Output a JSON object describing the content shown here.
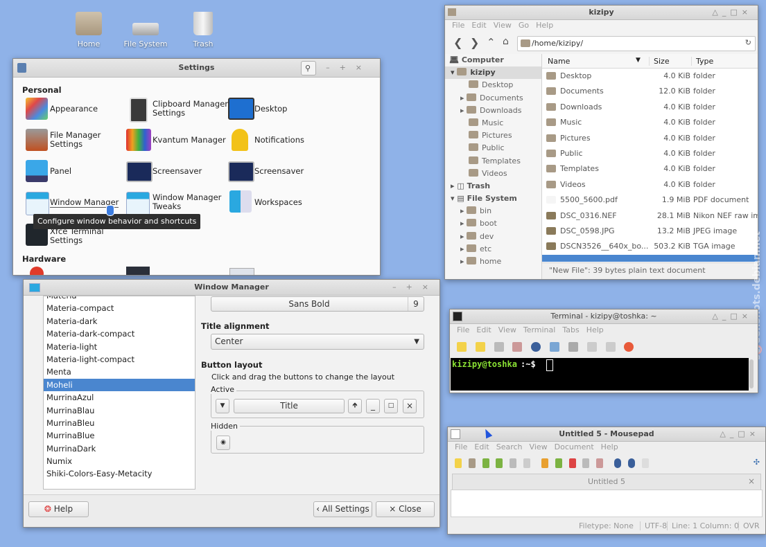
{
  "desktop": {
    "icons": [
      {
        "label": "Home"
      },
      {
        "label": "File System"
      },
      {
        "label": "Trash"
      }
    ]
  },
  "settings": {
    "title": "Settings",
    "personal_heading": "Personal",
    "hardware_heading": "Hardware",
    "items": [
      {
        "label": "Appearance"
      },
      {
        "label": "Clipboard Manager\nSettings"
      },
      {
        "label": "Desktop"
      },
      {
        "label": "File Manager\nSettings"
      },
      {
        "label": "Kvantum Manager"
      },
      {
        "label": "Notifications"
      },
      {
        "label": "Panel"
      },
      {
        "label": "Screensaver"
      },
      {
        "label": "Screensaver"
      },
      {
        "label": "Window Manager"
      },
      {
        "label": "Window Manager\nTweaks"
      },
      {
        "label": "Workspaces"
      },
      {
        "label": "Xfce Terminal\nSettings"
      }
    ],
    "tooltip": "Configure window behavior and shortcuts"
  },
  "wm": {
    "title": "Window Manager",
    "themes": [
      "Materia",
      "Materia-compact",
      "Materia-dark",
      "Materia-dark-compact",
      "Materia-light",
      "Materia-light-compact",
      "Menta",
      "Moheli",
      "MurrinaAzul",
      "MurrinaBlau",
      "MurrinaBleu",
      "MurrinaBlue",
      "MurrinaDark",
      "Numix",
      "Shiki-Colors-Easy-Metacity"
    ],
    "selected_theme": "Moheli",
    "font_name": "Sans Bold",
    "font_size": "9",
    "title_alignment_heading": "Title alignment",
    "title_alignment_value": "Center",
    "button_layout_heading": "Button layout",
    "button_layout_hint": "Click and drag the buttons to change the layout",
    "active_label": "Active",
    "title_button": "Title",
    "hidden_label": "Hidden",
    "help_button": "Help",
    "all_settings_button": "All Settings",
    "close_button": "Close"
  },
  "fm": {
    "title": "kizipy",
    "menu": [
      "File",
      "Edit",
      "View",
      "Go",
      "Help"
    ],
    "path": "/home/kizipy/",
    "computer_label": "Computer",
    "tree": [
      {
        "label": "kizipy",
        "bold": true
      },
      {
        "label": "Desktop"
      },
      {
        "label": "Documents"
      },
      {
        "label": "Downloads"
      },
      {
        "label": "Music"
      },
      {
        "label": "Pictures"
      },
      {
        "label": "Public"
      },
      {
        "label": "Templates"
      },
      {
        "label": "Videos"
      },
      {
        "label": "Trash",
        "bold": true
      },
      {
        "label": "File System",
        "bold": true
      },
      {
        "label": "bin"
      },
      {
        "label": "boot"
      },
      {
        "label": "dev"
      },
      {
        "label": "etc"
      },
      {
        "label": "home"
      }
    ],
    "columns": [
      "Name",
      "Size",
      "Type"
    ],
    "rows": [
      {
        "name": "Desktop",
        "size": "4.0 KiB",
        "type": "folder"
      },
      {
        "name": "Documents",
        "size": "12.0 KiB",
        "type": "folder"
      },
      {
        "name": "Downloads",
        "size": "4.0 KiB",
        "type": "folder"
      },
      {
        "name": "Music",
        "size": "4.0 KiB",
        "type": "folder"
      },
      {
        "name": "Pictures",
        "size": "4.0 KiB",
        "type": "folder"
      },
      {
        "name": "Public",
        "size": "4.0 KiB",
        "type": "folder"
      },
      {
        "name": "Templates",
        "size": "4.0 KiB",
        "type": "folder"
      },
      {
        "name": "Videos",
        "size": "4.0 KiB",
        "type": "folder"
      },
      {
        "name": "5500_5600.pdf",
        "size": "1.9 MiB",
        "type": "PDF document"
      },
      {
        "name": "DSC_0316.NEF",
        "size": "28.1 MiB",
        "type": "Nikon NEF raw im"
      },
      {
        "name": "DSC_0598.JPG",
        "size": "13.2 MiB",
        "type": "JPEG image"
      },
      {
        "name": "DSCN3526__640x_bo...",
        "size": "503.2 KiB",
        "type": "TGA image"
      }
    ],
    "status": "\"New File\": 39 bytes plain text document"
  },
  "terminal": {
    "title": "Terminal - kizipy@toshka: ~",
    "menu": [
      "File",
      "Edit",
      "View",
      "Terminal",
      "Tabs",
      "Help"
    ],
    "prompt_user": "kizipy@toshka",
    "prompt_rest": ":~$"
  },
  "mousepad": {
    "title": "Untitled 5 - Mousepad",
    "menu": [
      "File",
      "Edit",
      "Search",
      "View",
      "Document",
      "Help"
    ],
    "tab": "Untitled 5",
    "status": {
      "filetype": "Filetype: None",
      "encoding": "UTF-8",
      "position": "Line: 1 Column: 0",
      "mode": "OVR"
    }
  },
  "watermark": "screenshots.debian.net"
}
